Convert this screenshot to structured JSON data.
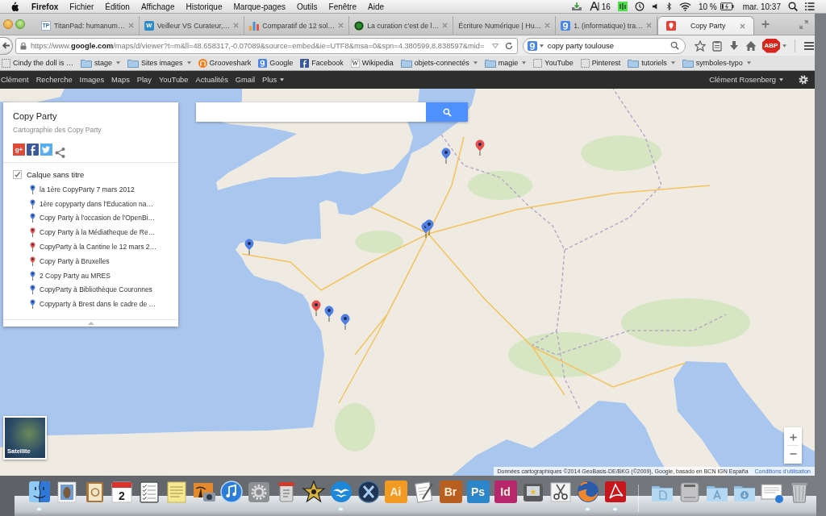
{
  "menu_bar": {
    "app": "Firefox",
    "menus": [
      "Fichier",
      "Édition",
      "Affichage",
      "Historique",
      "Marque-pages",
      "Outils",
      "Fenêtre",
      "Aide"
    ],
    "status_count": "16",
    "battery": "10 %",
    "clock": "mar. 10:37"
  },
  "tabs": [
    {
      "title": "TitanPad: humanum…",
      "kind": "letters",
      "glyph": "TP",
      "selected": false
    },
    {
      "title": "Veilleur VS Curateur,…",
      "kind": "w-circle",
      "glyph": "W",
      "selected": false
    },
    {
      "title": "Comparatif de 12 sol…",
      "kind": "chart",
      "selected": false
    },
    {
      "title": "La curation c'est de l…",
      "kind": "ring",
      "selected": false
    },
    {
      "title": "Écriture Numérique | Hu…",
      "kind": "plain",
      "selected": false
    },
    {
      "title": "1. (informatique) tra…",
      "kind": "g-logo",
      "selected": false
    },
    {
      "title": "Copy Party",
      "kind": "pin-tile",
      "selected": true
    }
  ],
  "address_bar": {
    "url": "https://www.**google.com**/maps/d/viewer?t=m&ll=48.658317,-0.07089&source=embed&ie=UTF8&msa=0&spn=4.380599,8.838597&mid="
  },
  "search_bar": {
    "value": "copy party toulouse"
  },
  "toolbar": {
    "badge_glyph": "ABP"
  },
  "bookmarks": [
    {
      "label": "Cindy the doll is …",
      "kind": "page",
      "dropdown": false
    },
    {
      "label": "stage",
      "kind": "folder",
      "dropdown": true
    },
    {
      "label": "Sites images",
      "kind": "folder",
      "dropdown": true
    },
    {
      "label": "Grooveshark",
      "kind": "headphones",
      "dropdown": false
    },
    {
      "label": "Google",
      "kind": "g-logo",
      "dropdown": false
    },
    {
      "label": "Facebook",
      "kind": "f-logo",
      "dropdown": false
    },
    {
      "label": "Wikipedia",
      "kind": "w-letter",
      "glyph": "W",
      "dropdown": false
    },
    {
      "label": "objets-connectés",
      "kind": "folder",
      "dropdown": true
    },
    {
      "label": "magie",
      "kind": "folder",
      "dropdown": true
    },
    {
      "label": "YouTube",
      "kind": "page",
      "dropdown": false
    },
    {
      "label": "Pinterest",
      "kind": "page",
      "dropdown": false
    },
    {
      "label": "tutoriels",
      "kind": "folder",
      "dropdown": true
    },
    {
      "label": "symboles-typo",
      "kind": "folder",
      "dropdown": true
    }
  ],
  "google_bar": {
    "links": [
      {
        "label": "Clément",
        "menu": false
      },
      {
        "label": "Recherche",
        "menu": false
      },
      {
        "label": "Images",
        "menu": false
      },
      {
        "label": "Maps",
        "menu": false
      },
      {
        "label": "Play",
        "menu": false
      },
      {
        "label": "YouTube",
        "menu": false
      },
      {
        "label": "Actualités",
        "menu": false
      },
      {
        "label": "Gmail",
        "menu": false
      },
      {
        "label": "Plus",
        "menu": true
      }
    ],
    "user": {
      "label": "Clément Rosenberg",
      "menu": true
    }
  },
  "map": {
    "panel": {
      "title": "Copy Party",
      "subtitle": "Cartographie des Copy Party",
      "share": [
        {
          "kind": "g-plus",
          "glyph": "g+"
        },
        {
          "kind": "f-logo"
        },
        {
          "kind": "bird"
        },
        {
          "kind": "share"
        }
      ],
      "layer": {
        "name": "Calque sans titre",
        "checked": true,
        "items": [
          {
            "label": "la 1ère CopyParty 7 mars 2012",
            "color": "#4f7fe0"
          },
          {
            "label": "1ère copyparty dans l'Education na…",
            "color": "#4f7fe0"
          },
          {
            "label": "Copy Party à l'occasion de l'OpenBi…",
            "color": "#4f7fe0"
          },
          {
            "label": "Copy Party à la Médiatheque de Re…",
            "color": "#e5504a"
          },
          {
            "label": "CopyParty à la Cantine le 12 mars 2…",
            "color": "#e5504a"
          },
          {
            "label": "Copy Party à Bruxelles",
            "color": "#e5504a"
          },
          {
            "label": "2 Copy Party au MRES",
            "color": "#4f7fe0"
          },
          {
            "label": "CopyParty à Bibliothèque Couronnes",
            "color": "#4f7fe0"
          },
          {
            "label": "Copyparty à Brest dans le cadre de …",
            "color": "#4f7fe0"
          }
        ]
      }
    },
    "markers": [
      {
        "color": "#4f7fe0"
      },
      {
        "color": "#e5504a"
      },
      {
        "color": "#4f7fe0"
      },
      {
        "color": "#4f7fe0"
      },
      {
        "color": "#4f7fe0"
      },
      {
        "color": "#e5504a"
      },
      {
        "color": "#4f7fe0"
      },
      {
        "color": "#4f7fe0"
      }
    ],
    "satellite_label": "Satellite",
    "attribution": "Données cartographiques ©2014 GeoBasis-DE/BKG (©2009), Google, basado en BCN IGN España",
    "terms_link": "Conditions d'utilisation"
  },
  "dock": {
    "apps": [
      {
        "kind": "face",
        "running": true
      },
      {
        "kind": "stamp",
        "running": false
      },
      {
        "kind": "address-book",
        "running": false
      },
      {
        "kind": "calendar",
        "glyph": "2",
        "running": false
      },
      {
        "kind": "checklist",
        "running": false
      },
      {
        "kind": "notepad",
        "running": false
      },
      {
        "kind": "photo",
        "running": false
      },
      {
        "kind": "music",
        "running": false
      },
      {
        "kind": "gear",
        "running": false
      },
      {
        "kind": "script",
        "running": false
      },
      {
        "kind": "star",
        "running": false
      },
      {
        "kind": "gulls",
        "running": true
      },
      {
        "kind": "x-circle",
        "running": false
      },
      {
        "kind": "letter-tile",
        "glyph": "Ai",
        "color": "#f29a22",
        "running": false
      },
      {
        "kind": "document",
        "running": false
      },
      {
        "kind": "letter-tile",
        "glyph": "Br",
        "color": "#b85e1e",
        "running": false
      },
      {
        "kind": "letter-tile",
        "glyph": "Ps",
        "color": "#2c86cc",
        "running": false
      },
      {
        "kind": "letter-tile",
        "glyph": "Id",
        "color": "#b8276c",
        "running": false
      },
      {
        "kind": "slideshow",
        "running": false
      },
      {
        "kind": "scissors",
        "running": false
      },
      {
        "kind": "globe",
        "running": true
      },
      {
        "kind": "swirl",
        "running": true
      }
    ],
    "places": [
      {
        "kind": "doc-folder"
      },
      {
        "kind": "drive"
      },
      {
        "kind": "apps-folder"
      },
      {
        "kind": "download-folder"
      },
      {
        "kind": "preview"
      },
      {
        "kind": "trash"
      }
    ]
  }
}
